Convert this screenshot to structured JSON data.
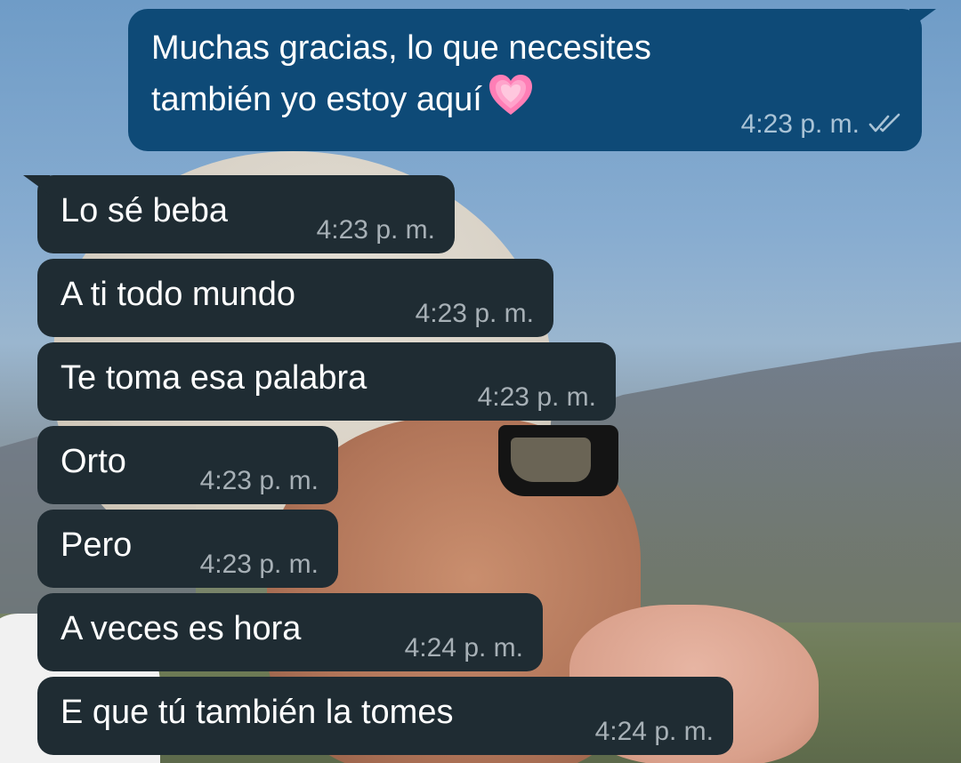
{
  "colors": {
    "incoming_bubble": "#1f2c33",
    "outgoing_bubble": "#0e4a77",
    "timestamp_in": "#a7b0b6",
    "timestamp_out": "#a9c3d6"
  },
  "outgoing_message": {
    "line1": "Muchas gracias, lo que necesites",
    "line2": "también yo estoy aquí",
    "emoji": "growing-heart-emoji",
    "time": "4:23 p. m.",
    "status_icon": "double-check-read-icon"
  },
  "incoming_messages": [
    {
      "text": "Lo sé beba",
      "time": "4:23 p. m."
    },
    {
      "text": "A ti todo mundo",
      "time": "4:23 p. m."
    },
    {
      "text": "Te toma esa palabra",
      "time": "4:23 p. m."
    },
    {
      "text": "Orto",
      "time": "4:23 p. m."
    },
    {
      "text": "Pero",
      "time": "4:23 p. m."
    },
    {
      "text": "A veces es hora",
      "time": "4:24 p. m."
    },
    {
      "text": "E que tú también la tomes",
      "time": "4:24 p. m."
    }
  ]
}
